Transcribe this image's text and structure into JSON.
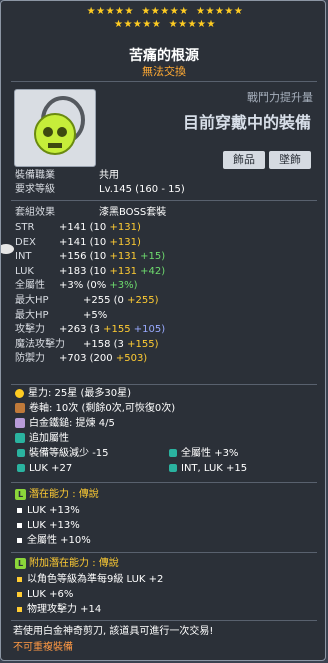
{
  "stars": {
    "row1": "★★★★★  ★★★★★  ★★★★★",
    "row2": "★★★★★  ★★★★★"
  },
  "item": {
    "name": "苦痛的根源",
    "trade": "無法交換"
  },
  "header": {
    "cp_label": "戰鬥力提升量",
    "cp_value": "目前穿戴中的裝備"
  },
  "tags": [
    "飾品",
    "墜飾"
  ],
  "requirements": {
    "job_label": "裝備職業",
    "job_value": "共用",
    "level_label": "要求等級",
    "level_value": "Lv.145",
    "level_extra": "(160 - 15)"
  },
  "set_effect": {
    "label": "套組效果",
    "value": "漆黑BOSS套裝"
  },
  "stats": [
    {
      "label": "STR",
      "total": "+141",
      "base": "(10",
      "p1": "+131)",
      "p2": ""
    },
    {
      "label": "DEX",
      "total": "+141",
      "base": "(10",
      "p1": "+131)",
      "p2": ""
    },
    {
      "label": "INT",
      "total": "+156",
      "base": "(10",
      "p1": "+131",
      "p2": "+15)"
    },
    {
      "label": "LUK",
      "total": "+183",
      "base": "(10",
      "p1": "+131",
      "p2": "+42)"
    },
    {
      "label": "全屬性",
      "total": "+3%",
      "base": "(0%",
      "p1": "",
      "p2": "+3%)"
    },
    {
      "label": "最大HP",
      "total": "+255",
      "base": "(0",
      "p1": "+255)",
      "p2": ""
    },
    {
      "label": "最大HP",
      "total": "+5%",
      "base": "",
      "p1": "",
      "p2": ""
    },
    {
      "label": "攻擊力",
      "total": "+263",
      "base": "(3",
      "p1": "+155",
      "p2": "+105)"
    },
    {
      "label": "魔法攻擊力",
      "total": "+158",
      "base": "(3",
      "p1": "+155)",
      "p2": ""
    },
    {
      "label": "防禦力",
      "total": "+703",
      "base": "(200",
      "p1": "+503)",
      "p2": ""
    }
  ],
  "starforce": {
    "label": "星力",
    "value": ": 25星 (最多30星)"
  },
  "scroll": {
    "label": "卷軸",
    "value": ": 10次 (剩餘0次,可恢復0次)"
  },
  "hammer": {
    "label": "白金鐵鎚",
    "value": ": 提煉 4/5"
  },
  "bonus": {
    "label": "追加屬性",
    "items": [
      {
        "name": "裝備等級減少",
        "val": "-15"
      },
      {
        "name": "全屬性",
        "val": "+3%"
      },
      {
        "name": "LUK",
        "val": "+27"
      },
      {
        "name": "INT, LUK",
        "val": "+15"
      }
    ]
  },
  "potential": {
    "badge": "L",
    "label": "潛在能力",
    "grade": ": 傳說",
    "lines": [
      "LUK +13%",
      "LUK +13%",
      "全屬性 +10%"
    ]
  },
  "additional": {
    "badge": "L",
    "label": "附加潛在能力",
    "grade": ": 傳說",
    "lines": [
      "以角色等級為準每9級 LUK +2",
      "LUK +6%",
      "物理攻擊力 +14"
    ]
  },
  "footer": {
    "note": "若使用白金神奇剪刀, 該道具可進行一次交易!",
    "warn": "不可重複裝備"
  }
}
